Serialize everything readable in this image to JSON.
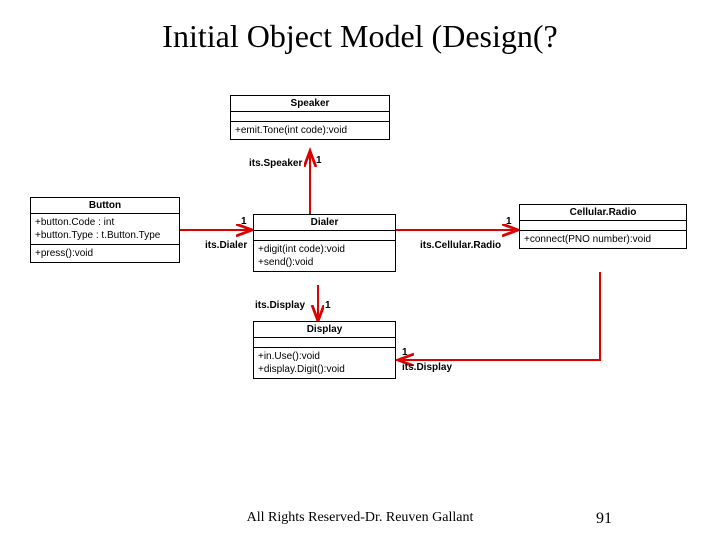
{
  "title": "Initial Object Model (Design(?",
  "footer": "All Rights Reserved-Dr. Reuven Gallant",
  "page_number": "91",
  "classes": {
    "speaker": {
      "name": "Speaker",
      "attrs": "",
      "ops": "+emit.Tone(int code):void"
    },
    "button": {
      "name": "Button",
      "attrs_line1": "+button.Code : int",
      "attrs_line2": "+button.Type : t.Button.Type",
      "ops": "+press():void"
    },
    "dialer": {
      "name": "Dialer",
      "attrs": "",
      "ops_line1": "+digit(int code):void",
      "ops_line2": "+send():void"
    },
    "cellular_radio": {
      "name": "Cellular.Radio",
      "attrs": "",
      "ops": "+connect(PNO number):void"
    },
    "display": {
      "name": "Display",
      "attrs": "",
      "ops_line1": "+in.Use():void",
      "ops_line2": "+display.Digit():void"
    }
  },
  "assoc": {
    "its_speaker": {
      "label": "its.Speaker",
      "mult": "1"
    },
    "its_dialer": {
      "label": "its.Dialer",
      "mult": "1"
    },
    "its_cellular_radio": {
      "label": "its.Cellular.Radio",
      "mult": "1"
    },
    "its_display_from_dialer": {
      "label": "its.Display",
      "mult": "1"
    },
    "its_display_from_radio": {
      "label": "its.Display",
      "mult": "1"
    }
  }
}
